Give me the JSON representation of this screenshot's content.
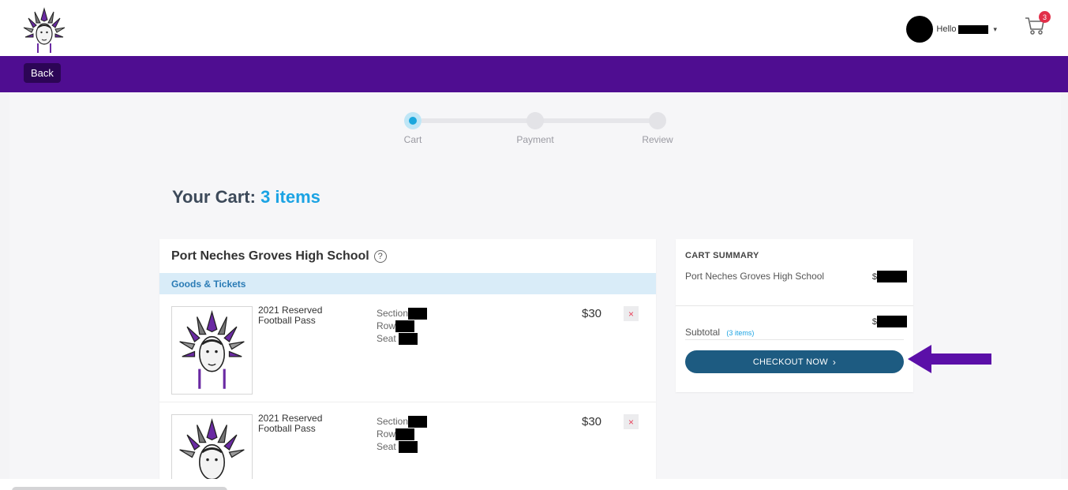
{
  "header": {
    "greeting": "Hello",
    "cart_count": "3"
  },
  "nav": {
    "back_label": "Back"
  },
  "stepper": {
    "steps": [
      {
        "label": "Cart",
        "active": true
      },
      {
        "label": "Payment",
        "active": false
      },
      {
        "label": "Review",
        "active": false
      }
    ]
  },
  "cart": {
    "title_prefix": "Your Cart:",
    "title_count": "3 items",
    "school_name": "Port Neches Groves High School",
    "help_symbol": "?",
    "section_label": "Goods & Tickets",
    "items": [
      {
        "name": "2021 Reserved Football Pass",
        "section_label": "Section",
        "row_label": "Row",
        "seat_label": "Seat",
        "price": "$30",
        "remove_symbol": "×"
      },
      {
        "name": "2021 Reserved Football Pass",
        "section_label": "Section",
        "row_label": "Row",
        "seat_label": "Seat",
        "price": "$30",
        "remove_symbol": "×"
      }
    ]
  },
  "summary": {
    "title": "CART SUMMARY",
    "school_line": "Port Neches Groves High School",
    "currency": "$",
    "subtotal_label": "Subtotal",
    "subtotal_count": "(3 items)",
    "checkout_label": "CHECKOUT NOW",
    "checkout_chevron": "›"
  },
  "colors": {
    "nav_purple": "#4f0d91",
    "accent_blue": "#1ba3e3",
    "checkout_blue": "#1d5b81",
    "badge_red": "#e2304a",
    "annotation_arrow": "#5b0fa8"
  },
  "icons": {
    "logo": "indian-headdress-logo-icon",
    "avatar": "user-avatar-icon",
    "cart": "shopping-cart-icon",
    "help": "question-circle-icon",
    "remove": "close-icon",
    "arrow": "left-arrow-icon"
  }
}
